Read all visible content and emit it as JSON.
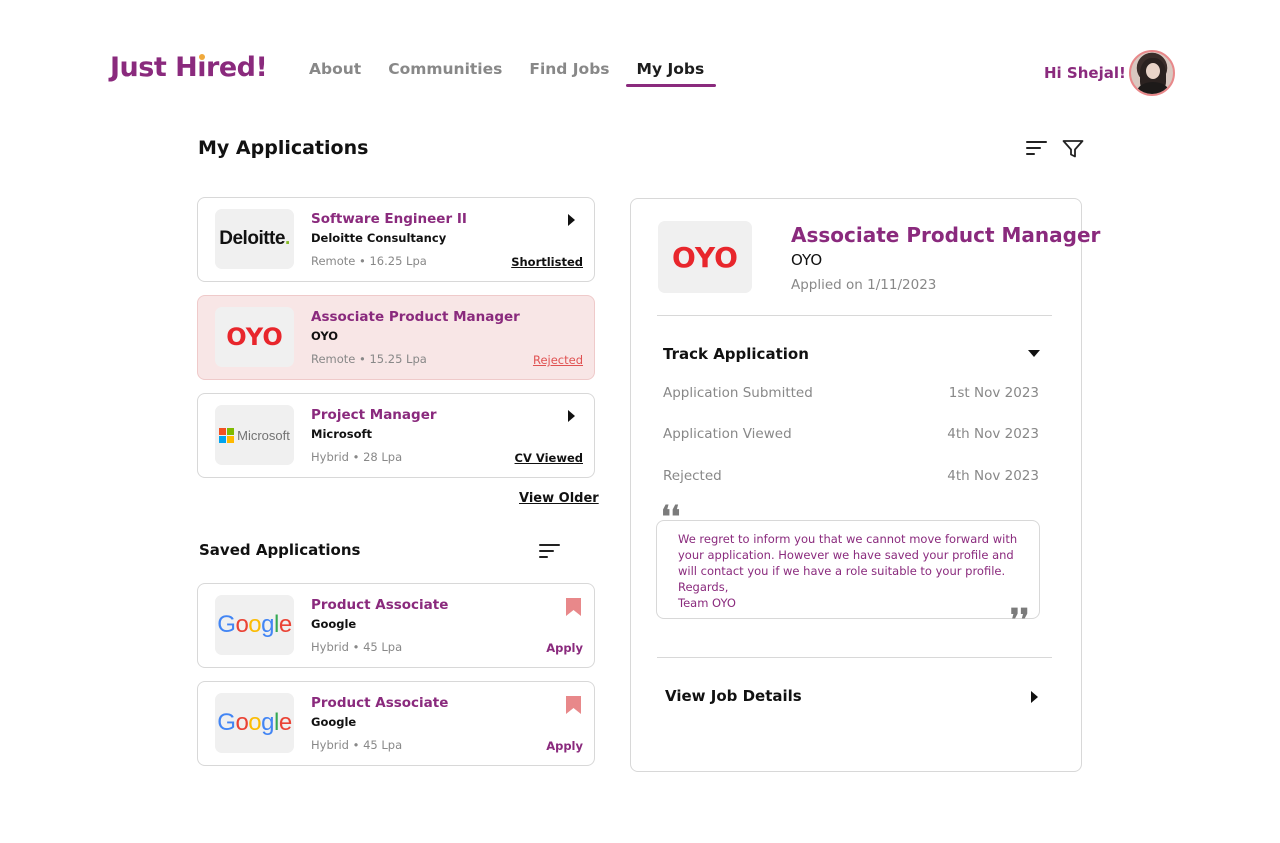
{
  "header": {
    "logo_text": "Just Hired!",
    "nav": [
      {
        "label": "About",
        "active": false
      },
      {
        "label": "Communities",
        "active": false
      },
      {
        "label": "Find Jobs",
        "active": false
      },
      {
        "label": "My Jobs",
        "active": true
      }
    ],
    "greeting": "Hi Shejal!",
    "avatar_icon": "user-avatar"
  },
  "colors": {
    "brand": "#8a2a7d",
    "rejected": "#e05252",
    "selected_card_bg": "#f8e6e6",
    "bookmark": "#e8888a"
  },
  "my_applications": {
    "title": "My Applications",
    "sort_icon": "sort-icon",
    "filter_icon": "filter-icon",
    "items": [
      {
        "company_logo": "Deloitte.",
        "title": "Software Engineer II",
        "company": "Deloitte Consultancy",
        "meta": "Remote • 16.25 Lpa",
        "status": "Shortlisted",
        "selected": false
      },
      {
        "company_logo": "OYO",
        "title": "Associate Product Manager",
        "company": "OYO",
        "meta": "Remote • 15.25 Lpa",
        "status": "Rejected",
        "selected": true
      },
      {
        "company_logo": "Microsoft",
        "title": "Project Manager",
        "company": "Microsoft",
        "meta": "Hybrid • 28 Lpa",
        "status": "CV Viewed",
        "selected": false
      }
    ],
    "view_older": "View Older"
  },
  "saved_applications": {
    "title": "Saved Applications",
    "items": [
      {
        "company_logo": "Google",
        "title": "Product Associate",
        "company": "Google",
        "meta": "Hybrid • 45 Lpa",
        "action": "Apply"
      },
      {
        "company_logo": "Google",
        "title": "Product Associate",
        "company": "Google",
        "meta": "Hybrid • 45 Lpa",
        "action": "Apply"
      }
    ]
  },
  "detail": {
    "company_logo": "OYO",
    "title": "Associate Product Manager",
    "company": "OYO",
    "applied": "Applied on 1/11/2023",
    "track_title": "Track Application",
    "steps": [
      {
        "label": "Application Submitted",
        "date": "1st Nov 2023"
      },
      {
        "label": "Application Viewed",
        "date": "4th Nov 2023"
      },
      {
        "label": "Rejected",
        "date": "4th Nov 2023"
      }
    ],
    "message": {
      "line1": "We regret to inform you that we cannot move forward with",
      "line2": "your application. However we have saved your profile and",
      "line3": "will contact you if we have a role suitable to your profile.",
      "line4": "Regards,",
      "line5": "Team OYO"
    },
    "quote_open": "❛❛",
    "quote_close": "❜❜",
    "view_details": "View Job Details"
  }
}
